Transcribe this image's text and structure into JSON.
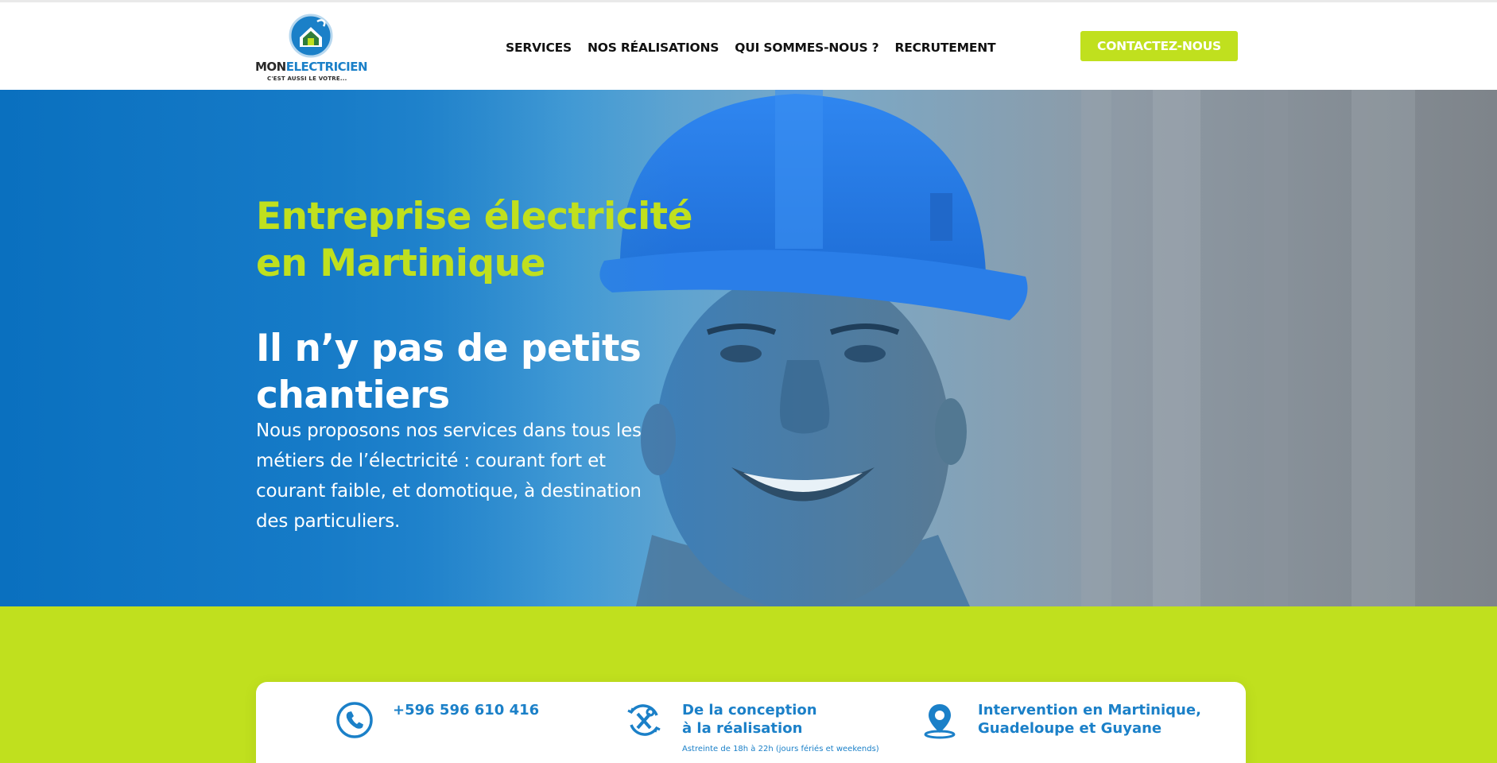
{
  "brand": {
    "name_part1": "MON",
    "name_part2": "ELECTRICIEN",
    "tagline": "C'EST AUSSI LE VOTRE..."
  },
  "nav": {
    "items": [
      {
        "label": "SERVICES"
      },
      {
        "label": "NOS RÉALISATIONS"
      },
      {
        "label": "QUI SOMMES-NOUS ?"
      },
      {
        "label": "RECRUTEMENT"
      }
    ],
    "cta_label": "CONTACTEZ-NOUS"
  },
  "hero": {
    "title_line1": "Entreprise électricité",
    "title_line2": "en Martinique",
    "subtitle_line1": "Il n’y pas de petits",
    "subtitle_line2": "chantiers",
    "text": "Nous proposons nos services dans tous les métiers de l’électricité : courant fort et courant faible, et domotique, à destination des particuliers."
  },
  "info": {
    "phone": "+596 596 610 416",
    "design_line1": "De la conception",
    "design_line2": "à la réalisation",
    "design_note": "Astreinte de 18h à 22h (jours fériés et weekends)",
    "area_line1": "Intervention en Martinique,",
    "area_line2": "Guadeloupe et Guyane"
  },
  "colors": {
    "accent_green": "#c0e01e",
    "brand_blue": "#1b80c8",
    "hero_blue": "#0a70bf"
  },
  "icons": [
    "phone-icon",
    "tools-icon",
    "map-pin-icon",
    "house-plug-icon"
  ]
}
